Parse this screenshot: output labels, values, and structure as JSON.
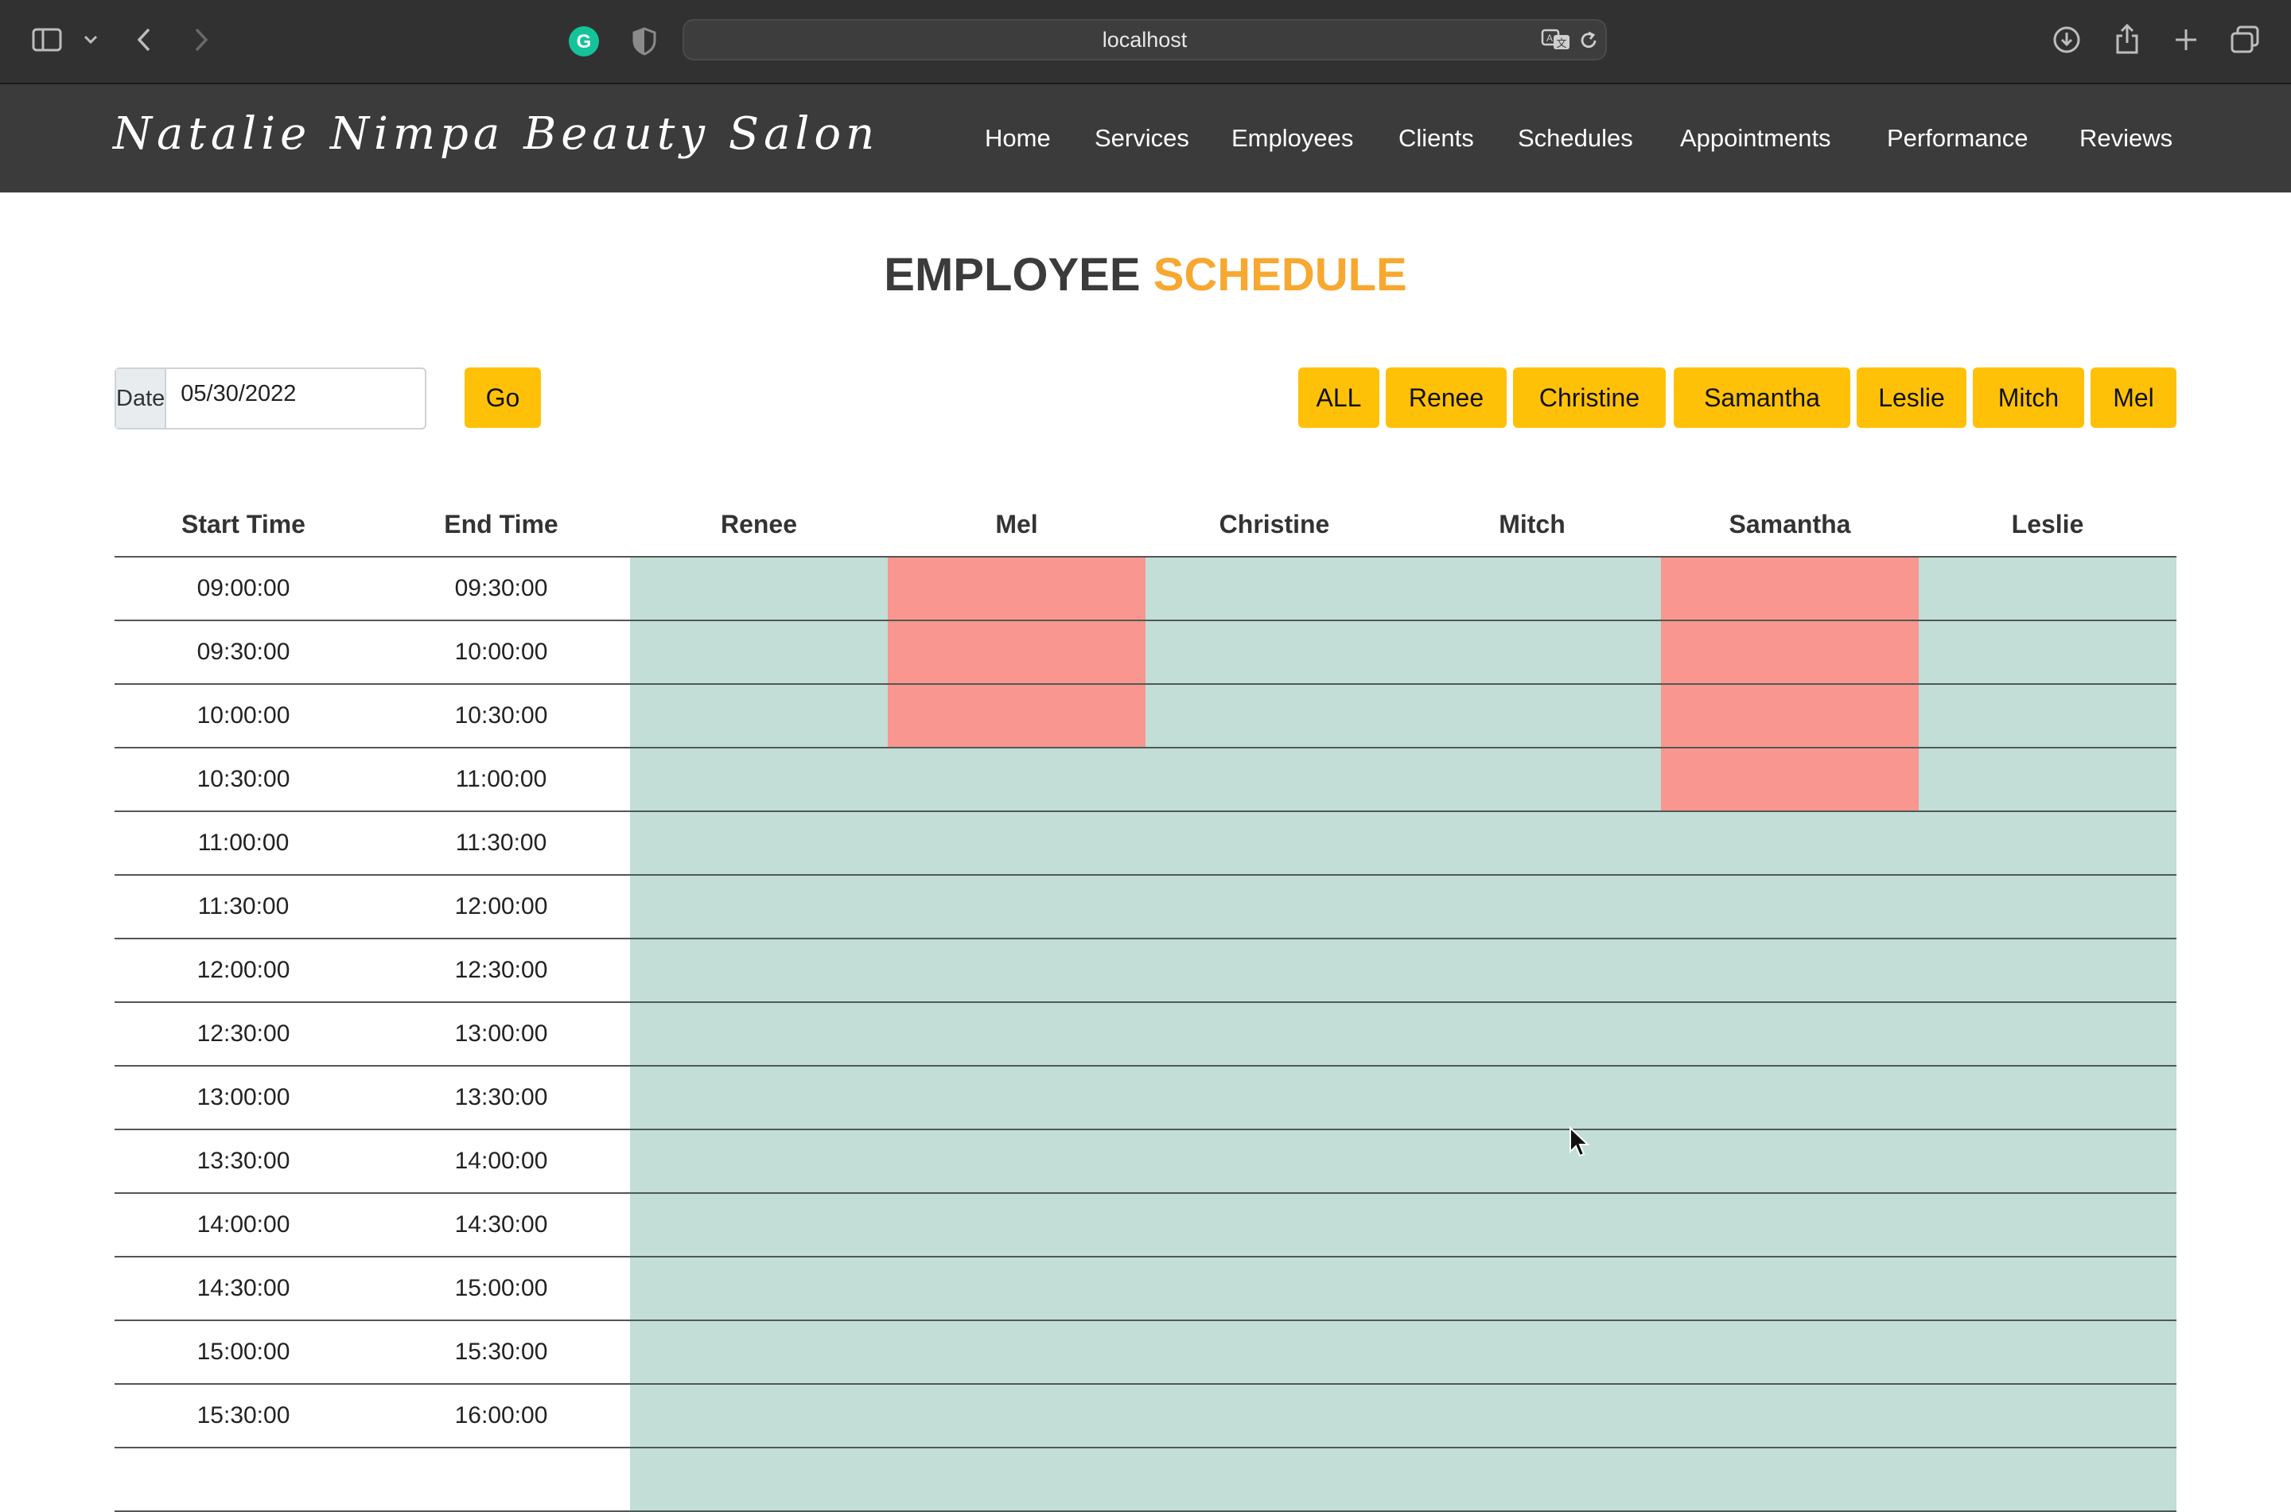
{
  "browser": {
    "url": "localhost",
    "icons": [
      "sidebar-icon",
      "chevron-down-icon",
      "back-icon",
      "forward-icon",
      "grammarly-icon",
      "shield-icon",
      "translate-icon",
      "reload-icon",
      "download-icon",
      "share-icon",
      "new-tab-icon",
      "tabs-overview-icon"
    ]
  },
  "site": {
    "brand": "Natalie Nimpa Beauty Salon",
    "nav": [
      "Home",
      "Services",
      "Employees",
      "Clients",
      "Schedules",
      "Appointments",
      "Performance",
      "Reviews"
    ]
  },
  "page": {
    "title_part1": "EMPLOYEE",
    "title_part2": "SCHEDULE",
    "date_label": "Date",
    "date_value": "05/30/2022",
    "go_label": "Go",
    "filters": [
      "ALL",
      "Renee",
      "Christine",
      "Samantha",
      "Leslie",
      "Mitch",
      "Mel"
    ]
  },
  "colors": {
    "accent": "#ffc107",
    "title_accent": "#f7a830",
    "free": "#c2ded7",
    "busy": "#f8968f",
    "nav_bg": "#3b3b3b"
  },
  "schedule": {
    "headers": [
      "Start Time",
      "End Time",
      "Renee",
      "Mel",
      "Christine",
      "Mitch",
      "Samantha",
      "Leslie"
    ],
    "rows": [
      {
        "start": "09:00:00",
        "end": "09:30:00",
        "status": [
          "free",
          "busy",
          "free",
          "free",
          "busy",
          "free"
        ]
      },
      {
        "start": "09:30:00",
        "end": "10:00:00",
        "status": [
          "free",
          "busy",
          "free",
          "free",
          "busy",
          "free"
        ]
      },
      {
        "start": "10:00:00",
        "end": "10:30:00",
        "status": [
          "free",
          "busy",
          "free",
          "free",
          "busy",
          "free"
        ]
      },
      {
        "start": "10:30:00",
        "end": "11:00:00",
        "status": [
          "free",
          "free",
          "free",
          "free",
          "busy",
          "free"
        ]
      },
      {
        "start": "11:00:00",
        "end": "11:30:00",
        "status": [
          "free",
          "free",
          "free",
          "free",
          "free",
          "free"
        ]
      },
      {
        "start": "11:30:00",
        "end": "12:00:00",
        "status": [
          "free",
          "free",
          "free",
          "free",
          "free",
          "free"
        ]
      },
      {
        "start": "12:00:00",
        "end": "12:30:00",
        "status": [
          "free",
          "free",
          "free",
          "free",
          "free",
          "free"
        ]
      },
      {
        "start": "12:30:00",
        "end": "13:00:00",
        "status": [
          "free",
          "free",
          "free",
          "free",
          "free",
          "free"
        ]
      },
      {
        "start": "13:00:00",
        "end": "13:30:00",
        "status": [
          "free",
          "free",
          "free",
          "free",
          "free",
          "free"
        ]
      },
      {
        "start": "13:30:00",
        "end": "14:00:00",
        "status": [
          "free",
          "free",
          "free",
          "free",
          "free",
          "free"
        ]
      },
      {
        "start": "14:00:00",
        "end": "14:30:00",
        "status": [
          "free",
          "free",
          "free",
          "free",
          "free",
          "free"
        ]
      },
      {
        "start": "14:30:00",
        "end": "15:00:00",
        "status": [
          "free",
          "free",
          "free",
          "free",
          "free",
          "free"
        ]
      },
      {
        "start": "15:00:00",
        "end": "15:30:00",
        "status": [
          "free",
          "free",
          "free",
          "free",
          "free",
          "free"
        ]
      },
      {
        "start": "15:30:00",
        "end": "16:00:00",
        "status": [
          "free",
          "free",
          "free",
          "free",
          "free",
          "free"
        ]
      },
      {
        "start": "",
        "end": "",
        "status": [
          "free",
          "free",
          "free",
          "free",
          "free",
          "free"
        ]
      }
    ]
  }
}
